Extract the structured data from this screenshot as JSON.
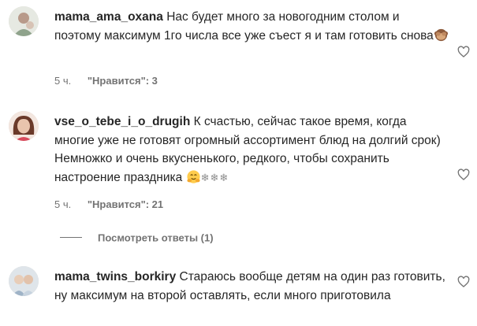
{
  "comments": [
    {
      "username": "mama_ama_oxana",
      "text": "Нас будет много за новогодним столом и поэтому максимум 1го числа все уже съест я и там готовить снова",
      "emoji": "monkey-hide-emoji",
      "time": "5 ч.",
      "likes": "\"Нравится\": 3",
      "avatar_color": "#cfd6c9"
    },
    {
      "username": "vse_o_tebe_i_o_drugih",
      "text": "К счастью, сейчас такое время, когда многие уже не готовят огромный ассортимент блюд на долгий срок) Немножко и очень вкусненького, редкого, чтобы сохранить настроение праздника",
      "emoji": "hugging-face-emoji",
      "snow": "❄❄❄",
      "time": "5 ч.",
      "likes": "\"Нравится\": 21",
      "avatar_color": "#c97a6a"
    },
    {
      "username": "mama_twins_borkiry",
      "text": "Стараюсь вообще детям на один раз готовить, ну максимум на второй оставлять, если много приготовила",
      "avatar_color": "#b9c4d0"
    }
  ],
  "replies_label": "Посмотреть ответы (1)",
  "colors": {
    "text": "#262626",
    "meta": "#737373",
    "accent": "#ffcc4d"
  }
}
